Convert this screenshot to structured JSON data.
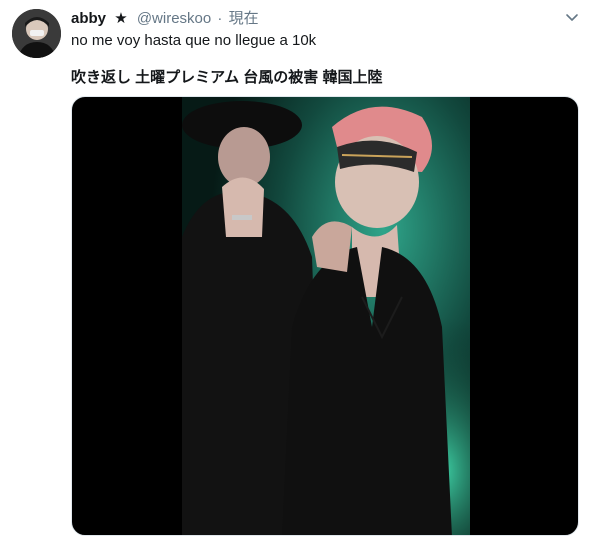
{
  "tweet": {
    "display_name": "abby",
    "star": "★",
    "handle": "@wireskoo",
    "separator": "·",
    "timestamp": "現在",
    "text": "no me voy hasta que no llegue a 10k",
    "quote_line": "吹き返し 土曜プレミアム 台風の被害 韓国上陸"
  },
  "icons": {
    "caret": "chevron-down-icon",
    "avatar": "avatar"
  },
  "colors": {
    "text": "#14171a",
    "secondary": "#657786",
    "media_bg": "#000000",
    "stage_green": "#1f7a63"
  }
}
